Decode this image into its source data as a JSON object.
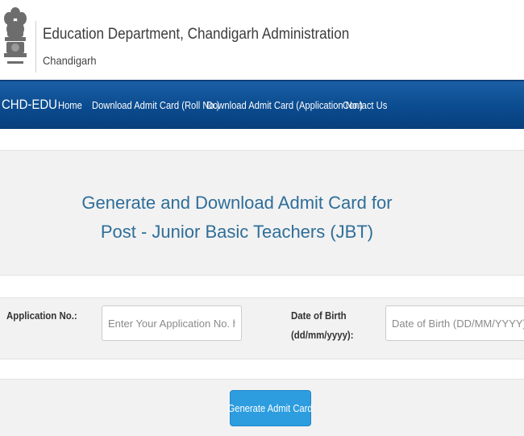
{
  "header": {
    "title": "Education Department, Chandigarh Administration",
    "subtitle": "Chandigarh",
    "emblem_icon": "ashoka-emblem-icon"
  },
  "nav": {
    "brand": "CHD-EDU",
    "items": [
      {
        "label": "Home"
      },
      {
        "label": "Download Admit Card (Roll No.)"
      },
      {
        "label": "Download Admit Card (Application No.)"
      },
      {
        "label": "Contact Us"
      }
    ],
    "color": "#0a4a8e"
  },
  "main": {
    "title_line1": "Generate and Download Admit Card for",
    "title_line2": "Post - Junior Basic Teachers (JBT)",
    "title_color": "#2e6e99"
  },
  "form": {
    "app_no_label": "Application No.:",
    "app_no_placeholder": "Enter Your Application No. here..",
    "app_no_value": "",
    "dob_label_line1": "Date of Birth",
    "dob_label_line2": "(dd/mm/yyyy):",
    "dob_placeholder": "Date of Birth (DD/MM/YYYY)",
    "dob_value": "",
    "submit_label": "Generate Admit Card",
    "button_color": "#2d9de0"
  }
}
